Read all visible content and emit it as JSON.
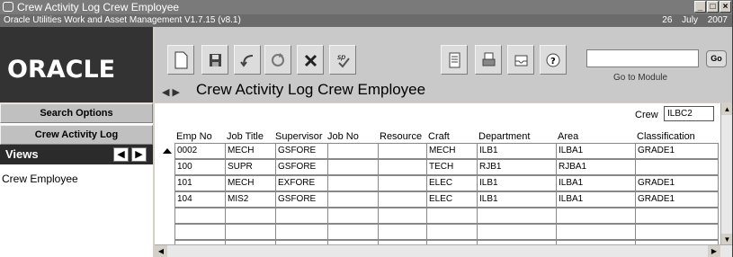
{
  "window": {
    "title": "Crew Activity Log Crew Employee",
    "app_info": "Oracle Utilities Work and Asset Management V1.7.15 (v8.1)",
    "date_day": "26 July",
    "date_year": "2007",
    "min": "_",
    "restore": "□",
    "close": "×"
  },
  "logo": {
    "text": "ORACLE"
  },
  "toolbar": {
    "goto_label": "Go to Module",
    "go_button": "Go",
    "goto_value": "",
    "nav_back": "◀",
    "nav_fwd": "▶"
  },
  "page": {
    "heading": "Crew Activity Log Crew Employee"
  },
  "nav": {
    "search_options": "Search Options",
    "crew_activity_log": "Crew Activity Log",
    "views_label": "Views",
    "views_prev": "◀",
    "views_next": "▶",
    "view_item": "Crew Employee"
  },
  "crew": {
    "label": "Crew",
    "value": "ILBC2"
  },
  "table": {
    "headers": [
      "Emp No",
      "Job Title",
      "Supervisor",
      "Job No",
      "Resource",
      "Craft",
      "Department",
      "Area",
      "Classification"
    ],
    "rows": [
      [
        "0002",
        "MECH",
        "GSFORE",
        "",
        "",
        "MECH",
        "ILB1",
        "ILBA1",
        "GRADE1"
      ],
      [
        "100",
        "SUPR",
        "GSFORE",
        "",
        "",
        "TECH",
        "RJB1",
        "RJBA1",
        ""
      ],
      [
        "101",
        "MECH",
        "EXFORE",
        "",
        "",
        "ELEC",
        "ILB1",
        "ILBA1",
        "GRADE1"
      ],
      [
        "104",
        "MIS2",
        "GSFORE",
        "",
        "",
        "ELEC",
        "ILB1",
        "ILBA1",
        "GRADE1"
      ],
      [
        "",
        "",
        "",
        "",
        "",
        "",
        "",
        "",
        ""
      ],
      [
        "",
        "",
        "",
        "",
        "",
        "",
        "",
        "",
        ""
      ],
      [
        "",
        "",
        "",
        "",
        "",
        "",
        "",
        "",
        ""
      ]
    ]
  },
  "colors": {
    "logo_bg": "#333333",
    "titlebar": "#7a7a7a",
    "views_header": "#2b2b2b"
  }
}
